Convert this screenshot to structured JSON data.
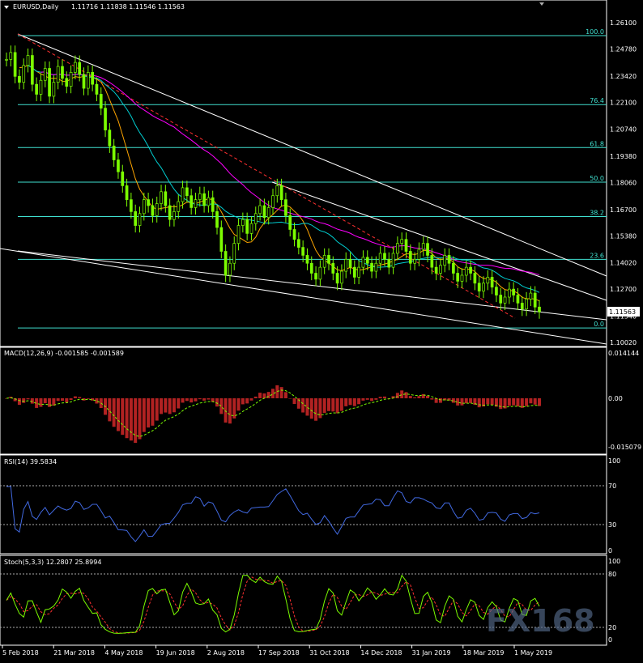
{
  "chart_data": [
    {
      "type": "candlestick",
      "title": "EURUSD,Daily",
      "ohlc_readout": "1.11716 1.11838 1.11546 1.11563",
      "last_price": "1.11563",
      "ylim": [
        1.1002,
        1.261
      ],
      "price_ticks": [
        "1.26100",
        "1.24780",
        "1.23420",
        "1.22100",
        "1.20740",
        "1.19380",
        "1.18060",
        "1.16700",
        "1.15380",
        "1.14020",
        "1.12700",
        "1.11340",
        "1.10020"
      ],
      "dates": [
        "5 Feb 2018",
        "21 Mar 2018",
        "4 May 2018",
        "19 Jun 2018",
        "2 Aug 2018",
        "17 Sep 2018",
        "31 Oct 2018",
        "14 Dec 2018",
        "31 Jan 2019",
        "18 Mar 2019",
        "1 May 2019"
      ],
      "close": [
        1.2425,
        1.246,
        1.234,
        1.231,
        1.2395,
        1.2445,
        1.23,
        1.225,
        1.232,
        1.238,
        1.224,
        1.231,
        1.239,
        1.233,
        1.229,
        1.236,
        1.241,
        1.235,
        1.228,
        1.236,
        1.23,
        1.225,
        1.218,
        1.207,
        1.199,
        1.192,
        1.186,
        1.179,
        1.172,
        1.166,
        1.159,
        1.165,
        1.172,
        1.169,
        1.164,
        1.17,
        1.176,
        1.169,
        1.162,
        1.166,
        1.171,
        1.178,
        1.174,
        1.168,
        1.172,
        1.175,
        1.169,
        1.173,
        1.166,
        1.158,
        1.146,
        1.134,
        1.14,
        1.15,
        1.159,
        1.162,
        1.155,
        1.16,
        1.165,
        1.169,
        1.163,
        1.168,
        1.174,
        1.179,
        1.172,
        1.164,
        1.157,
        1.152,
        1.148,
        1.144,
        1.14,
        1.135,
        1.132,
        1.138,
        1.144,
        1.14,
        1.135,
        1.13,
        1.136,
        1.142,
        1.138,
        1.133,
        1.138,
        1.143,
        1.14,
        1.136,
        1.14,
        1.145,
        1.142,
        1.138,
        1.145,
        1.15,
        1.152,
        1.146,
        1.14,
        1.142,
        1.147,
        1.15,
        1.144,
        1.138,
        1.135,
        1.139,
        1.144,
        1.14,
        1.135,
        1.131,
        1.134,
        1.138,
        1.135,
        1.13,
        1.126,
        1.13,
        1.133,
        1.128,
        1.124,
        1.12,
        1.123,
        1.127,
        1.124,
        1.12,
        1.117,
        1.122,
        1.125,
        1.118,
        1.1156
      ],
      "indicators": {
        "fib_levels": [
          {
            "label": "100.0",
            "value": 1.2545
          },
          {
            "label": "76.4",
            "value": 1.2198
          },
          {
            "label": "61.8",
            "value": 1.1982
          },
          {
            "label": "50.0",
            "value": 1.1808
          },
          {
            "label": "38.2",
            "value": 1.1635
          },
          {
            "label": "23.6",
            "value": 1.142
          },
          {
            "label": "0.0",
            "value": 1.1075
          }
        ],
        "ma_colors": {
          "fast": "#ffa500",
          "mid": "#00ced1",
          "slow": "#ff00ff"
        }
      }
    },
    {
      "type": "bar",
      "title": "MACD(12,26,9) -0.001585 -0.001589",
      "ylim": [
        -0.015079,
        0.014144
      ],
      "ticks": [
        "0.014144",
        "0.00",
        "-0.015079"
      ],
      "histogram_color": "#b22222",
      "signal_color": "#7cfc00"
    },
    {
      "type": "line",
      "title": "RSI(14) 39.5834",
      "ylim": [
        0,
        100
      ],
      "ticks": [
        "100",
        "70",
        "30",
        "0"
      ],
      "line_color": "#4169e1"
    },
    {
      "type": "line",
      "title": "Stoch(5,3,3) 12.2807 25.8994",
      "ylim": [
        0,
        100
      ],
      "ticks": [
        "100",
        "80",
        "20",
        "0"
      ],
      "main_color": "#7cfc00",
      "signal_color": "#ff3030"
    }
  ],
  "watermark": "FX168"
}
